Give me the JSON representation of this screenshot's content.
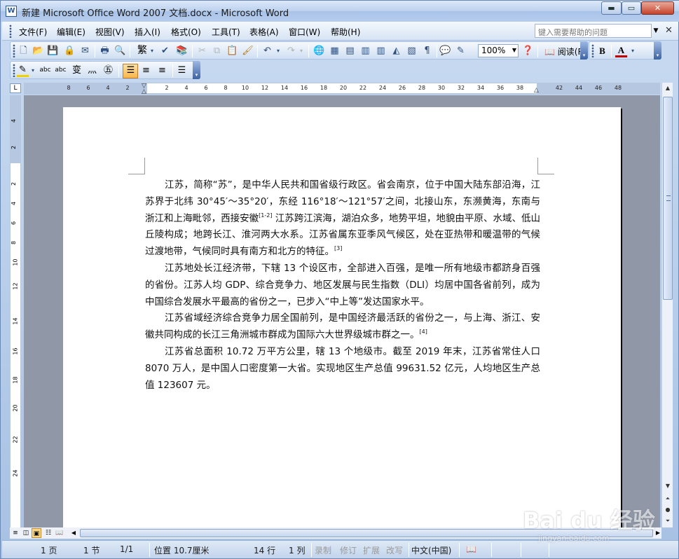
{
  "window": {
    "title": "新建 Microsoft Office Word 2007 文档.docx - Microsoft Word",
    "app_icon": "W",
    "minimize_glyph": "▬",
    "maximize_glyph": "▭",
    "close_glyph": "✕"
  },
  "menubar": {
    "items": [
      "文件(F)",
      "编辑(E)",
      "视图(V)",
      "插入(I)",
      "格式(O)",
      "工具(T)",
      "表格(A)",
      "窗口(W)",
      "帮助(H)"
    ],
    "help_placeholder": "键入需要帮助的问题",
    "help_arrow": "▼",
    "doc_close": "✕"
  },
  "toolbar_standard": {
    "zoom": "100%",
    "read_label": "阅读(R)",
    "font_bold_label": "B",
    "font_color_label": "A",
    "traditional_label": "繁"
  },
  "ruler": {
    "corner_label": "L",
    "h_ticks": [
      "8",
      "6",
      "4",
      "2",
      "2",
      "4",
      "6",
      "8",
      "10",
      "12",
      "14",
      "16",
      "18",
      "20",
      "22",
      "24",
      "26",
      "28",
      "30",
      "32",
      "34",
      "36",
      "38",
      "42",
      "44",
      "46",
      "48"
    ],
    "v_ticks": [
      "4",
      "2",
      "2",
      "4",
      "6",
      "8",
      "10",
      "12",
      "14",
      "16",
      "18",
      "20",
      "22",
      "24"
    ]
  },
  "document": {
    "paragraphs": [
      {
        "text": "江苏，简称“苏”，是中华人民共和国省级行政区。省会南京，位于中国大陆东部沿海，江苏界于北纬 30°45′～35°20′，东经 116°18′～121°57′之间，北接山东，东濒黄海，东南与浙江和上海毗邻，西接安徽",
        "ref": "[1-2]",
        "tail": " 江苏跨江滨海，湖泊众多，地势平坦，地貌由平原、水域、低山丘陵构成；地跨长江、淮河两大水系。江苏省属东亚季风气候区，处在亚热带和暖温带的气候过渡地带，气候同时具有南方和北方的特征。",
        "end_ref": "[3]"
      },
      {
        "text": "江苏地处长江经济带，下辖 13 个设区市，全部进入百强，是唯一所有地级市都跻身百强的省份。江苏人均 GDP、综合竞争力、地区发展与民生指数（DLI）均居中国各省前列，成为中国综合发展水平最高的省份之一，已步入“中上等”发达国家水平。",
        "ref": "",
        "tail": "",
        "end_ref": ""
      },
      {
        "text": "江苏省域经济综合竞争力居全国前列，是中国经济最活跃的省份之一，与上海、浙江、安徽共同构成的长江三角洲城市群成为国际六大世界级城市群之一。",
        "ref": "",
        "tail": "",
        "end_ref": "[4]"
      },
      {
        "text": "江苏省总面积 10.72 万平方公里，辖 13 个地级市。截至 2019 年末，江苏省常住人口 8070 万人，是中国人口密度第一大省。实现地区生产总值 99631.52 亿元，人均地区生产总值 123607 元。",
        "ref": "",
        "tail": "",
        "end_ref": ""
      }
    ]
  },
  "statusbar": {
    "page": "1 页",
    "section": "1 节",
    "page_of": "1/1",
    "position": "位置 10.7厘米",
    "line": "14 行",
    "column": "1 列",
    "rec": "录制",
    "trk": "修订",
    "ext": "扩展",
    "ovr": "改写",
    "language": "中文(中国)"
  },
  "watermark": {
    "main": "Bai du 经验",
    "sub": "jingyan.baidu.com"
  }
}
